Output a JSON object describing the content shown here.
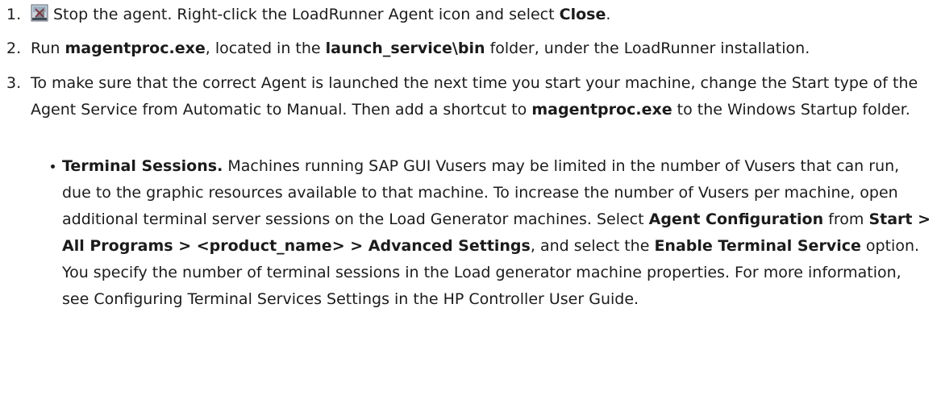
{
  "step1": {
    "number": "1.",
    "text_a": "Stop the agent. Right-click the LoadRunner Agent icon and select",
    "bold_close": "Close",
    "text_b": "."
  },
  "step2": {
    "number": "2.",
    "text_a": "Run",
    "bold_exe": "magentproc.exe",
    "text_b": ", located in the",
    "bold_folder": "launch_service\\bin",
    "text_c": "folder, under the LoadRunner installation."
  },
  "step3": {
    "number": "3.",
    "text_a": "To make sure that the correct Agent is launched the next time you start your machine, change the Start type of the Agent Service from Automatic to Manual. Then add a shortcut to",
    "bold_exe": "magentproc.exe",
    "text_b": "to the Windows Startup folder."
  },
  "bullet": {
    "bold_title": "Terminal Sessions.",
    "text_a": "Machines running SAP GUI Vusers may be limited in the number of Vusers that can run, due to the graphic resources available to that machine. To increase the number of Vusers per machine, open additional terminal server sessions on the Load Generator machines. Select",
    "bold_agent_config": "Agent Configuration",
    "text_b": "from",
    "bold_menu_path": "Start > All Programs > <product_name> > Advanced Settings",
    "text_c": ", and select the",
    "bold_enable": "Enable Terminal Service",
    "text_d": "option. You specify the number of terminal sessions in the Load generator machine properties. For more information, see Configuring Terminal Services Settings in the HP Controller User Guide."
  },
  "icons": {
    "agent_icon": "loadrunner-agent-icon"
  }
}
